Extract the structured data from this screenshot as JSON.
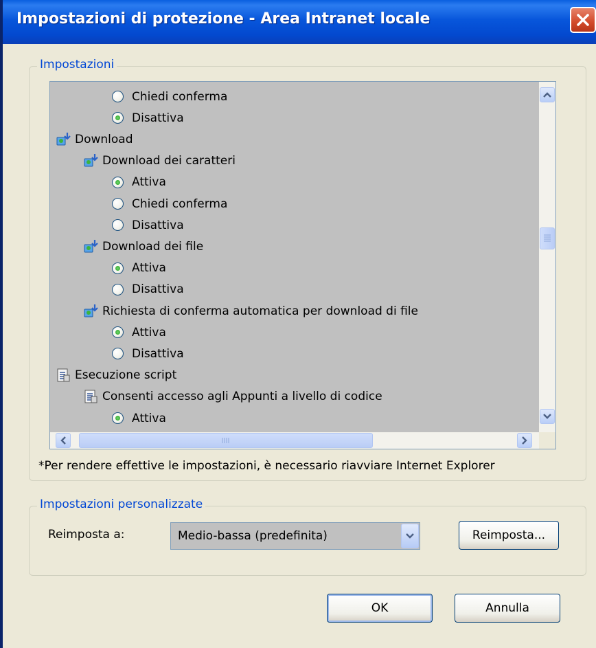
{
  "window": {
    "title": "Impostazioni di protezione - Area Intranet locale"
  },
  "settings_group": {
    "legend": "Impostazioni",
    "items": [
      {
        "type": "radio",
        "label": "Chiedi conferma",
        "checked": false,
        "level": 2
      },
      {
        "type": "radio",
        "label": "Disattiva",
        "checked": true,
        "level": 2
      },
      {
        "type": "category",
        "label": "Download",
        "icon": "download-category-icon",
        "level": 0
      },
      {
        "type": "subcategory",
        "label": "Download dei caratteri",
        "icon": "download-setting-icon",
        "level": 1
      },
      {
        "type": "radio",
        "label": "Attiva",
        "checked": true,
        "level": 2
      },
      {
        "type": "radio",
        "label": "Chiedi conferma",
        "checked": false,
        "level": 2
      },
      {
        "type": "radio",
        "label": "Disattiva",
        "checked": false,
        "level": 2
      },
      {
        "type": "subcategory",
        "label": "Download dei file",
        "icon": "download-setting-icon",
        "level": 1
      },
      {
        "type": "radio",
        "label": "Attiva",
        "checked": true,
        "level": 2
      },
      {
        "type": "radio",
        "label": "Disattiva",
        "checked": false,
        "level": 2
      },
      {
        "type": "subcategory",
        "label": "Richiesta di conferma automatica per download di file",
        "icon": "download-setting-icon",
        "level": 1
      },
      {
        "type": "radio",
        "label": "Attiva",
        "checked": true,
        "level": 2
      },
      {
        "type": "radio",
        "label": "Disattiva",
        "checked": false,
        "level": 2
      },
      {
        "type": "category",
        "label": "Esecuzione script",
        "icon": "script-category-icon",
        "level": 0
      },
      {
        "type": "subcategory",
        "label": "Consenti accesso agli Appunti a livello di codice",
        "icon": "script-setting-icon",
        "level": 1
      },
      {
        "type": "radio",
        "label": "Attiva",
        "checked": true,
        "level": 2
      }
    ],
    "note": "*Per rendere effettive le impostazioni, è necessario riavviare Internet Explorer"
  },
  "custom_group": {
    "legend": "Impostazioni personalizzate",
    "reset_label": "Reimposta a:",
    "reset_value": "Medio-bassa (predefinita)",
    "reset_button": "Reimposta..."
  },
  "buttons": {
    "ok": "OK",
    "cancel": "Annulla"
  },
  "colors": {
    "titlebar": "#0A5FE0",
    "legend_text": "#0046D5",
    "dialog_bg": "#ECE9D8",
    "list_bg": "#C0C0C0",
    "radio_dot": "#21A121"
  }
}
